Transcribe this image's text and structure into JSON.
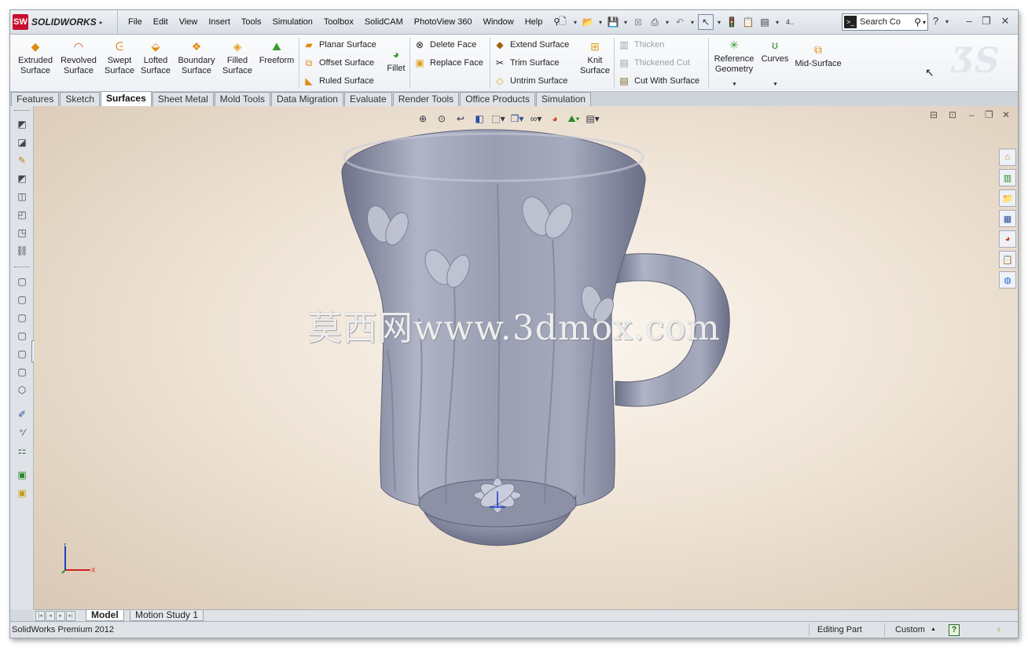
{
  "app": {
    "logo_mark": "SW",
    "logo_text": "SOLIDWORKS"
  },
  "menu": [
    "File",
    "Edit",
    "View",
    "Insert",
    "Tools",
    "Simulation",
    "Toolbox",
    "SolidCAM",
    "PhotoView 360",
    "Window",
    "Help"
  ],
  "search": {
    "value": "Search Co",
    "help": "?"
  },
  "ribbon": {
    "extruded": "Extruded\nSurface",
    "extruded_l1": "Extruded",
    "extruded_l2": "Surface",
    "revolved_l1": "Revolved",
    "revolved_l2": "Surface",
    "swept_l1": "Swept",
    "swept_l2": "Surface",
    "lofted_l1": "Lofted",
    "lofted_l2": "Surface",
    "boundary_l1": "Boundary",
    "boundary_l2": "Surface",
    "filled_l1": "Filled",
    "filled_l2": "Surface",
    "freeform": "Freeform",
    "planar": "Planar Surface",
    "offset": "Offset Surface",
    "ruled": "Ruled Surface",
    "fillet": "Fillet",
    "delete_face": "Delete Face",
    "replace_face": "Replace Face",
    "extend": "Extend Surface",
    "trim": "Trim Surface",
    "untrim": "Untrim Surface",
    "knit_l1": "Knit",
    "knit_l2": "Surface",
    "thicken": "Thicken",
    "thickened_cut": "Thickened Cut",
    "cut_with_surface": "Cut With Surface",
    "refgeo_l1": "Reference",
    "refgeo_l2": "Geometry",
    "curves": "Curves",
    "midsurface": "Mid-Surface"
  },
  "tabs": [
    "Features",
    "Sketch",
    "Surfaces",
    "Sheet Metal",
    "Mold Tools",
    "Data Migration",
    "Evaluate",
    "Render Tools",
    "Office Products",
    "Simulation"
  ],
  "active_tab": "Surfaces",
  "watermark": "莫西网www.3dmox.com",
  "triad": {
    "x": "X",
    "y": "Y"
  },
  "bottom_tabs": [
    "Model",
    "Motion Study 1"
  ],
  "status": {
    "left": "SolidWorks Premium 2012",
    "mode": "Editing Part",
    "units": "Custom",
    "units_caret": "▲",
    "help": "?"
  },
  "colors": {
    "accent": "#c8102e",
    "model": "#a9adbd",
    "axis_x": "#d22020",
    "axis_y": "#2040c0"
  }
}
